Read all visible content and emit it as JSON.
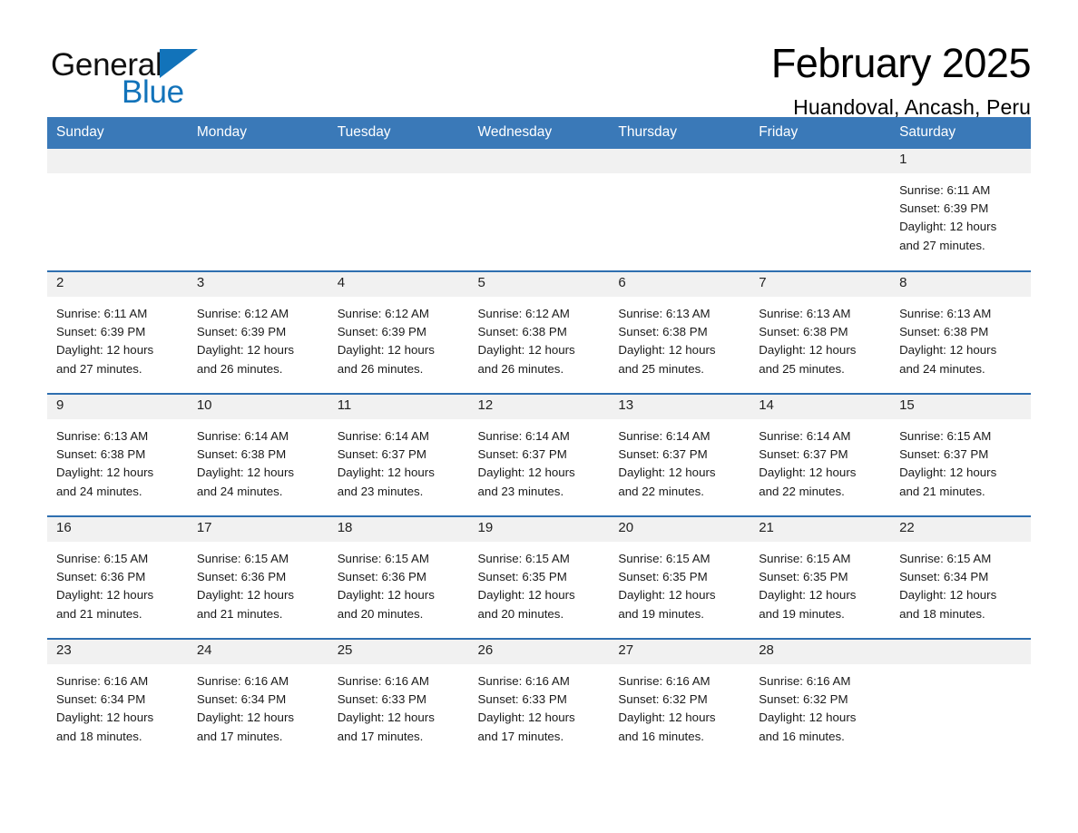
{
  "brand": {
    "name_part1": "General",
    "name_part2": "Blue",
    "triangle_color": "#1273ba"
  },
  "header": {
    "month_title": "February 2025",
    "location": "Huandoval, Ancash, Peru"
  },
  "theme": {
    "header_blue": "#3a79b8",
    "row_divider_blue": "#2f6fb0",
    "daynum_band_gray": "#f1f1f1"
  },
  "weekday_headers": [
    "Sunday",
    "Monday",
    "Tuesday",
    "Wednesday",
    "Thursday",
    "Friday",
    "Saturday"
  ],
  "weeks": [
    [
      {
        "day": "",
        "sunrise": "",
        "sunset": "",
        "daylight_line1": "",
        "daylight_line2": ""
      },
      {
        "day": "",
        "sunrise": "",
        "sunset": "",
        "daylight_line1": "",
        "daylight_line2": ""
      },
      {
        "day": "",
        "sunrise": "",
        "sunset": "",
        "daylight_line1": "",
        "daylight_line2": ""
      },
      {
        "day": "",
        "sunrise": "",
        "sunset": "",
        "daylight_line1": "",
        "daylight_line2": ""
      },
      {
        "day": "",
        "sunrise": "",
        "sunset": "",
        "daylight_line1": "",
        "daylight_line2": ""
      },
      {
        "day": "",
        "sunrise": "",
        "sunset": "",
        "daylight_line1": "",
        "daylight_line2": ""
      },
      {
        "day": "1",
        "sunrise": "Sunrise: 6:11 AM",
        "sunset": "Sunset: 6:39 PM",
        "daylight_line1": "Daylight: 12 hours",
        "daylight_line2": "and 27 minutes."
      }
    ],
    [
      {
        "day": "2",
        "sunrise": "Sunrise: 6:11 AM",
        "sunset": "Sunset: 6:39 PM",
        "daylight_line1": "Daylight: 12 hours",
        "daylight_line2": "and 27 minutes."
      },
      {
        "day": "3",
        "sunrise": "Sunrise: 6:12 AM",
        "sunset": "Sunset: 6:39 PM",
        "daylight_line1": "Daylight: 12 hours",
        "daylight_line2": "and 26 minutes."
      },
      {
        "day": "4",
        "sunrise": "Sunrise: 6:12 AM",
        "sunset": "Sunset: 6:39 PM",
        "daylight_line1": "Daylight: 12 hours",
        "daylight_line2": "and 26 minutes."
      },
      {
        "day": "5",
        "sunrise": "Sunrise: 6:12 AM",
        "sunset": "Sunset: 6:38 PM",
        "daylight_line1": "Daylight: 12 hours",
        "daylight_line2": "and 26 minutes."
      },
      {
        "day": "6",
        "sunrise": "Sunrise: 6:13 AM",
        "sunset": "Sunset: 6:38 PM",
        "daylight_line1": "Daylight: 12 hours",
        "daylight_line2": "and 25 minutes."
      },
      {
        "day": "7",
        "sunrise": "Sunrise: 6:13 AM",
        "sunset": "Sunset: 6:38 PM",
        "daylight_line1": "Daylight: 12 hours",
        "daylight_line2": "and 25 minutes."
      },
      {
        "day": "8",
        "sunrise": "Sunrise: 6:13 AM",
        "sunset": "Sunset: 6:38 PM",
        "daylight_line1": "Daylight: 12 hours",
        "daylight_line2": "and 24 minutes."
      }
    ],
    [
      {
        "day": "9",
        "sunrise": "Sunrise: 6:13 AM",
        "sunset": "Sunset: 6:38 PM",
        "daylight_line1": "Daylight: 12 hours",
        "daylight_line2": "and 24 minutes."
      },
      {
        "day": "10",
        "sunrise": "Sunrise: 6:14 AM",
        "sunset": "Sunset: 6:38 PM",
        "daylight_line1": "Daylight: 12 hours",
        "daylight_line2": "and 24 minutes."
      },
      {
        "day": "11",
        "sunrise": "Sunrise: 6:14 AM",
        "sunset": "Sunset: 6:37 PM",
        "daylight_line1": "Daylight: 12 hours",
        "daylight_line2": "and 23 minutes."
      },
      {
        "day": "12",
        "sunrise": "Sunrise: 6:14 AM",
        "sunset": "Sunset: 6:37 PM",
        "daylight_line1": "Daylight: 12 hours",
        "daylight_line2": "and 23 minutes."
      },
      {
        "day": "13",
        "sunrise": "Sunrise: 6:14 AM",
        "sunset": "Sunset: 6:37 PM",
        "daylight_line1": "Daylight: 12 hours",
        "daylight_line2": "and 22 minutes."
      },
      {
        "day": "14",
        "sunrise": "Sunrise: 6:14 AM",
        "sunset": "Sunset: 6:37 PM",
        "daylight_line1": "Daylight: 12 hours",
        "daylight_line2": "and 22 minutes."
      },
      {
        "day": "15",
        "sunrise": "Sunrise: 6:15 AM",
        "sunset": "Sunset: 6:37 PM",
        "daylight_line1": "Daylight: 12 hours",
        "daylight_line2": "and 21 minutes."
      }
    ],
    [
      {
        "day": "16",
        "sunrise": "Sunrise: 6:15 AM",
        "sunset": "Sunset: 6:36 PM",
        "daylight_line1": "Daylight: 12 hours",
        "daylight_line2": "and 21 minutes."
      },
      {
        "day": "17",
        "sunrise": "Sunrise: 6:15 AM",
        "sunset": "Sunset: 6:36 PM",
        "daylight_line1": "Daylight: 12 hours",
        "daylight_line2": "and 21 minutes."
      },
      {
        "day": "18",
        "sunrise": "Sunrise: 6:15 AM",
        "sunset": "Sunset: 6:36 PM",
        "daylight_line1": "Daylight: 12 hours",
        "daylight_line2": "and 20 minutes."
      },
      {
        "day": "19",
        "sunrise": "Sunrise: 6:15 AM",
        "sunset": "Sunset: 6:35 PM",
        "daylight_line1": "Daylight: 12 hours",
        "daylight_line2": "and 20 minutes."
      },
      {
        "day": "20",
        "sunrise": "Sunrise: 6:15 AM",
        "sunset": "Sunset: 6:35 PM",
        "daylight_line1": "Daylight: 12 hours",
        "daylight_line2": "and 19 minutes."
      },
      {
        "day": "21",
        "sunrise": "Sunrise: 6:15 AM",
        "sunset": "Sunset: 6:35 PM",
        "daylight_line1": "Daylight: 12 hours",
        "daylight_line2": "and 19 minutes."
      },
      {
        "day": "22",
        "sunrise": "Sunrise: 6:15 AM",
        "sunset": "Sunset: 6:34 PM",
        "daylight_line1": "Daylight: 12 hours",
        "daylight_line2": "and 18 minutes."
      }
    ],
    [
      {
        "day": "23",
        "sunrise": "Sunrise: 6:16 AM",
        "sunset": "Sunset: 6:34 PM",
        "daylight_line1": "Daylight: 12 hours",
        "daylight_line2": "and 18 minutes."
      },
      {
        "day": "24",
        "sunrise": "Sunrise: 6:16 AM",
        "sunset": "Sunset: 6:34 PM",
        "daylight_line1": "Daylight: 12 hours",
        "daylight_line2": "and 17 minutes."
      },
      {
        "day": "25",
        "sunrise": "Sunrise: 6:16 AM",
        "sunset": "Sunset: 6:33 PM",
        "daylight_line1": "Daylight: 12 hours",
        "daylight_line2": "and 17 minutes."
      },
      {
        "day": "26",
        "sunrise": "Sunrise: 6:16 AM",
        "sunset": "Sunset: 6:33 PM",
        "daylight_line1": "Daylight: 12 hours",
        "daylight_line2": "and 17 minutes."
      },
      {
        "day": "27",
        "sunrise": "Sunrise: 6:16 AM",
        "sunset": "Sunset: 6:32 PM",
        "daylight_line1": "Daylight: 12 hours",
        "daylight_line2": "and 16 minutes."
      },
      {
        "day": "28",
        "sunrise": "Sunrise: 6:16 AM",
        "sunset": "Sunset: 6:32 PM",
        "daylight_line1": "Daylight: 12 hours",
        "daylight_line2": "and 16 minutes."
      },
      {
        "day": "",
        "sunrise": "",
        "sunset": "",
        "daylight_line1": "",
        "daylight_line2": ""
      }
    ]
  ]
}
